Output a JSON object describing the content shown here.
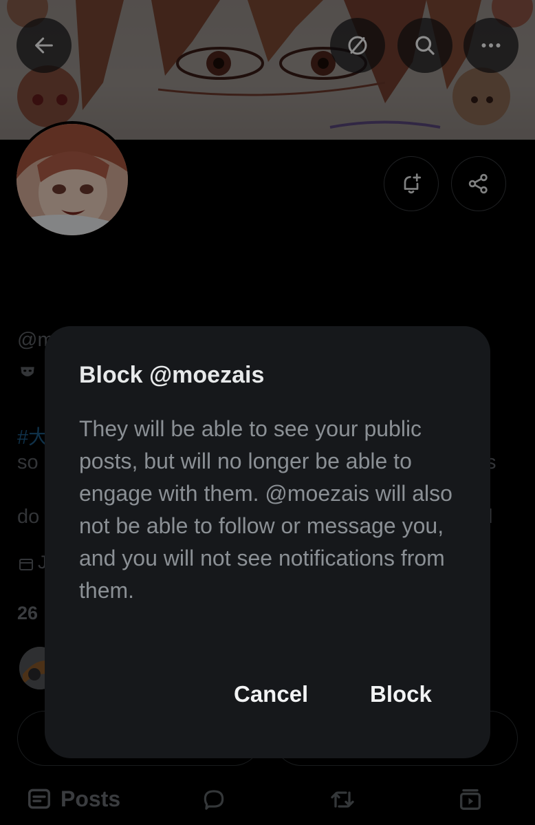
{
  "header": {
    "back_icon": "arrow-left-icon",
    "translate_icon": "slashed-circle-icon",
    "search_icon": "search-icon",
    "more_icon": "more-horizontal-icon"
  },
  "profile": {
    "notify_icon": "bell-plus-icon",
    "share_icon": "share-icon",
    "handle_fragment": "@m",
    "hashtag_fragment": "#大",
    "bio_line1_fragment": "so",
    "bio_line1_right_fragment": "s",
    "bio_line2_fragment": "do",
    "bio_line2_right_fragment": "l",
    "joined_fragment": "J",
    "follow_count_fragment": "26"
  },
  "dialog": {
    "title": "Block @moezais",
    "body": "They will be able to see your public posts, but will no longer be able to engage with them. @moezais will also not be able to follow or message you, and you will not see notifications from them.",
    "cancel_label": "Cancel",
    "block_label": "Block"
  },
  "tabs": {
    "posts_label": "Posts",
    "posts_icon": "posts-icon",
    "replies_icon": "reply-bubble-icon",
    "reposts_icon": "repost-icon",
    "media_icon": "video-icon"
  }
}
